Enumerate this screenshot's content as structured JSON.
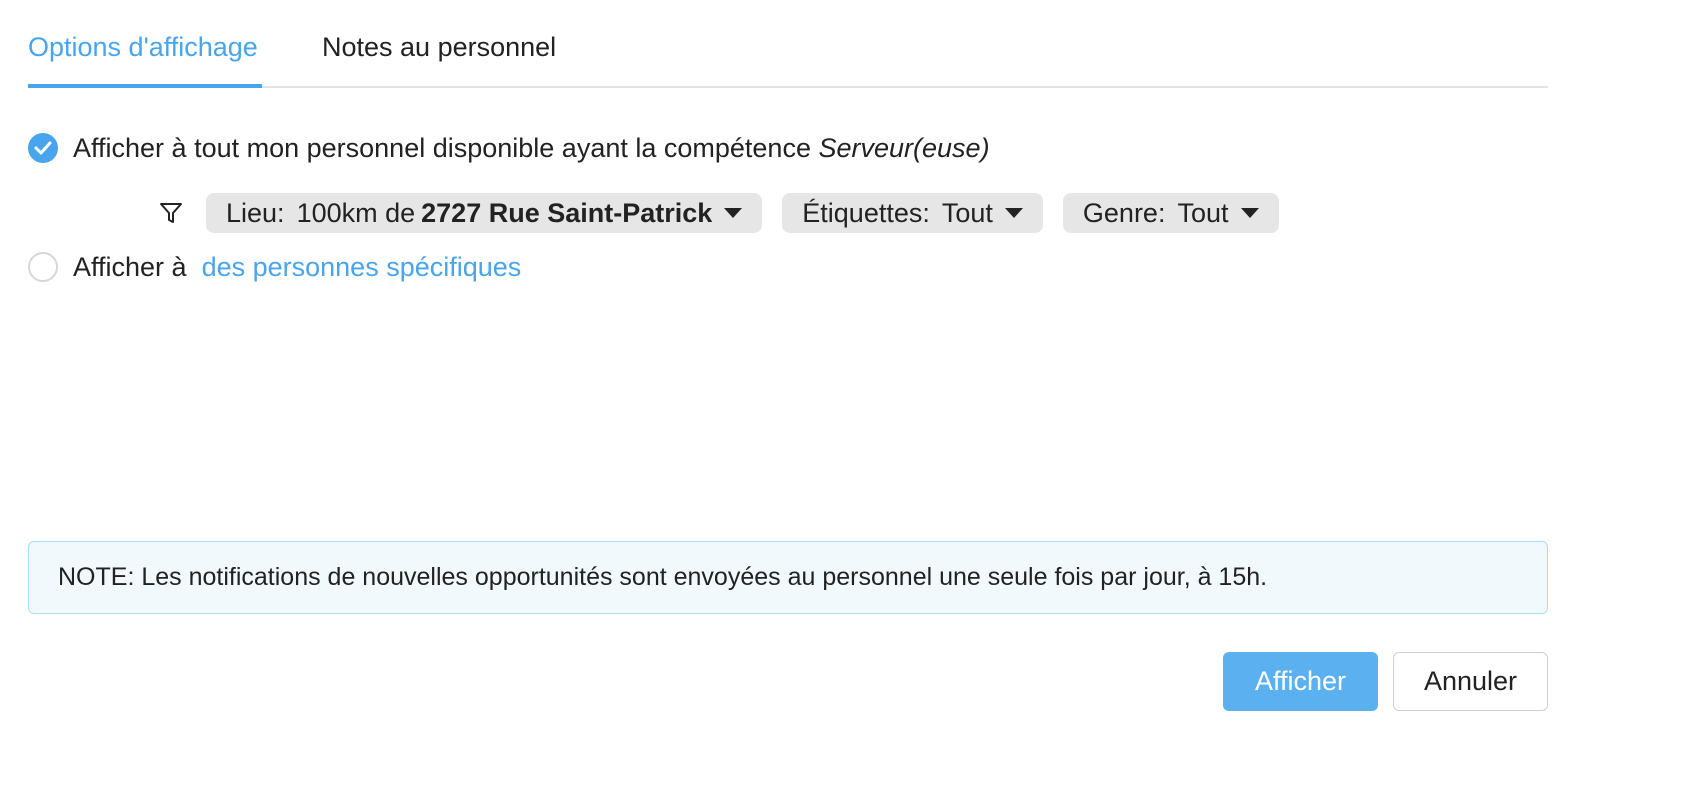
{
  "tabs": [
    {
      "label": "Options d'affichage",
      "active": true
    },
    {
      "label": "Notes au personnel",
      "active": false
    }
  ],
  "option_all_staff": {
    "checked": true,
    "label": "Afficher à tout mon personnel disponible ayant la compétence",
    "skill": "Serveur(euse)"
  },
  "filters": {
    "icon": "filter-icon",
    "location": {
      "label": "Lieu:",
      "distance": "100km de",
      "address": "2727 Rue Saint-Patrick"
    },
    "tags": {
      "label": "Étiquettes:",
      "value": "Tout"
    },
    "gender": {
      "label": "Genre:",
      "value": "Tout"
    }
  },
  "option_specific": {
    "checked": false,
    "label": "Afficher à",
    "link": "des personnes spécifiques"
  },
  "note": "NOTE: Les notifications de nouvelles opportunités sont envoyées au personnel une seule fois par jour, à 15h.",
  "buttons": {
    "primary": "Afficher",
    "secondary": "Annuler"
  },
  "colors": {
    "accent": "#48a4ec",
    "primary_button": "#5bb0f0",
    "note_bg": "#f1f9fc",
    "note_border": "#a9dff2",
    "pill_bg": "#e6e6e6"
  }
}
